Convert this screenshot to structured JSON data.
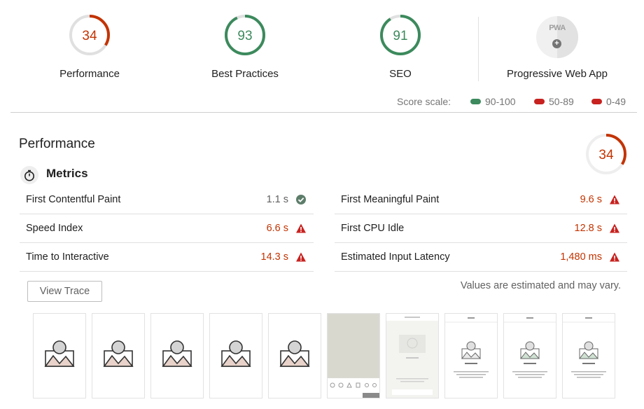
{
  "colors": {
    "fail": "#c33300",
    "fail_icon": "#c7221f",
    "pass": "#0b8043",
    "pass_gauge": "#3c8a5d",
    "track": "#e0e0e0"
  },
  "gauges": [
    {
      "score": "34",
      "label": "Performance",
      "status": "fail"
    },
    {
      "score": "93",
      "label": "Best Practices",
      "status": "pass"
    },
    {
      "score": "91",
      "label": "SEO",
      "status": "pass"
    }
  ],
  "pwa": {
    "badge_text": "PWA",
    "label": "Progressive Web App",
    "icon": "plus-icon"
  },
  "score_scale": {
    "label": "Score scale:",
    "items": [
      {
        "range": "90-100",
        "color": "#3c8a5d"
      },
      {
        "range": "50-89",
        "color": "#c7221f"
      },
      {
        "range": "0-49",
        "color": "#c7221f"
      }
    ]
  },
  "performance": {
    "title": "Performance",
    "score": "34",
    "metrics_title": "Metrics",
    "metrics": [
      {
        "label": "First Contentful Paint",
        "value": "1.1 s",
        "status": "pass"
      },
      {
        "label": "First Meaningful Paint",
        "value": "9.6 s",
        "status": "fail"
      },
      {
        "label": "Speed Index",
        "value": "6.6 s",
        "status": "fail"
      },
      {
        "label": "First CPU Idle",
        "value": "12.8 s",
        "status": "fail"
      },
      {
        "label": "Time to Interactive",
        "value": "14.3 s",
        "status": "fail"
      },
      {
        "label": "Estimated Input Latency",
        "value": "1,480 ms",
        "status": "fail"
      }
    ],
    "view_trace": "View Trace",
    "estimate_note": "Values are estimated and may vary."
  },
  "filmstrip": [
    {
      "kind": "placeholder"
    },
    {
      "kind": "placeholder"
    },
    {
      "kind": "placeholder"
    },
    {
      "kind": "placeholder"
    },
    {
      "kind": "placeholder"
    },
    {
      "kind": "grey"
    },
    {
      "kind": "faded"
    },
    {
      "kind": "page"
    },
    {
      "kind": "page"
    },
    {
      "kind": "page"
    }
  ]
}
